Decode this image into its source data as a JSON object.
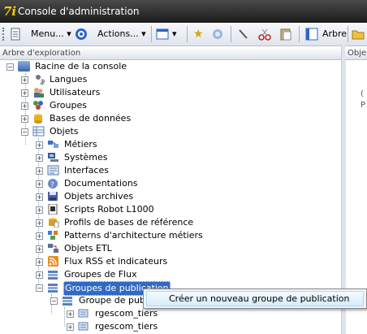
{
  "window": {
    "title": "Console d'administration",
    "logo_text": "7i"
  },
  "toolbar": {
    "menu_label": "Menu...",
    "actions_label": "Actions...",
    "tree_label": "Arbre"
  },
  "left_pane": {
    "header": "Arbre d'exploration"
  },
  "right_pane": {
    "header": "Obje",
    "snippet_lines": [
      "(",
      "P"
    ]
  },
  "tree": {
    "root": "Racine de la console",
    "items": [
      {
        "label": "Langues",
        "icon": "languages-icon",
        "color": "#7a8794"
      },
      {
        "label": "Utilisateurs",
        "icon": "users-icon",
        "color": "#6d7b8c"
      },
      {
        "label": "Groupes",
        "icon": "groups-icon",
        "color": "#4f9a3a"
      },
      {
        "label": "Bases de données",
        "icon": "database-icon",
        "color": "#e4b21b"
      },
      {
        "label": "Objets",
        "icon": "objects-icon",
        "color": "#5a7fb8"
      }
    ],
    "objets_children": [
      {
        "label": "Métiers",
        "icon": "business-icon",
        "color": "#3f70c0"
      },
      {
        "label": "Systèmes",
        "icon": "systems-icon",
        "color": "#3a5a99"
      },
      {
        "label": "Interfaces",
        "icon": "interfaces-icon",
        "color": "#5779ad"
      },
      {
        "label": "Documentations",
        "icon": "documentation-icon",
        "color": "#6a8ac9"
      },
      {
        "label": "Objets archives",
        "icon": "archive-icon",
        "color": "#4b5fa6"
      },
      {
        "label": "Scripts Robot L1000",
        "icon": "script-icon",
        "color": "#2f2f2f"
      },
      {
        "label": "Profils de bases de référence",
        "icon": "profile-icon",
        "color": "#d9a21a"
      },
      {
        "label": "Patterns d'architecture métiers",
        "icon": "pattern-icon",
        "color": "#3e7fd0"
      },
      {
        "label": "Objets ETL",
        "icon": "etl-icon",
        "color": "#5a6f9a"
      },
      {
        "label": "Flux RSS et indicateurs",
        "icon": "rss-icon",
        "color": "#f08a1c"
      },
      {
        "label": "Groupes de Flux",
        "icon": "flux-group-icon",
        "color": "#5a7fb8"
      },
      {
        "label": "Groupes de publication",
        "icon": "publication-group-icon",
        "color": "#5a7fb8"
      }
    ],
    "publication_child": "Groupe de publi",
    "publication_grandchildren": [
      "rgescom_tiers",
      "rgescom_tiers"
    ]
  },
  "context_menu": {
    "item": "Créer un nouveau groupe de publication"
  }
}
